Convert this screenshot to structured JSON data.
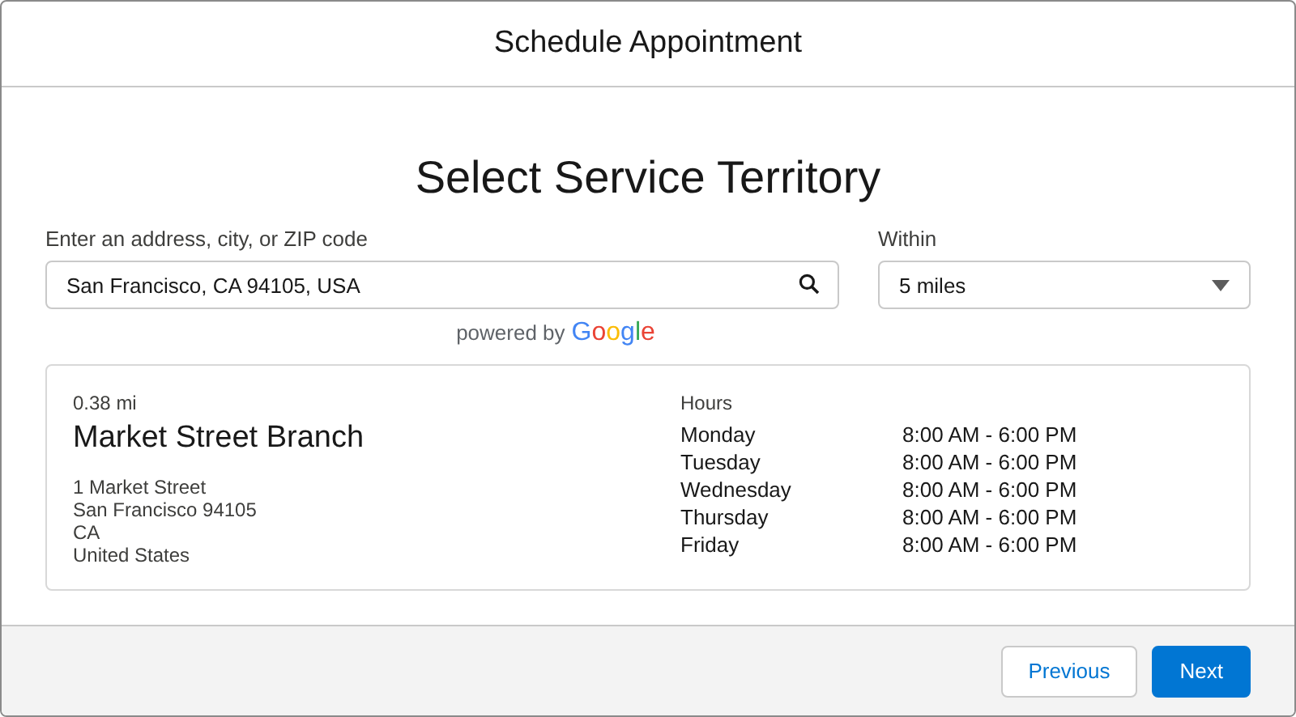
{
  "window": {
    "title": "Schedule Appointment"
  },
  "heading": "Select Service Territory",
  "address": {
    "label": "Enter an address, city, or ZIP code",
    "value": "San Francisco, CA 94105, USA"
  },
  "within": {
    "label": "Within",
    "value": "5 miles"
  },
  "attribution": {
    "text": "powered by",
    "logo": "Google"
  },
  "result": {
    "distance": "0.38 mi",
    "name": "Market Street Branch",
    "address_lines": [
      "1 Market Street",
      "San Francisco 94105",
      "CA",
      "United States"
    ],
    "hours_label": "Hours",
    "hours": [
      {
        "day": "Monday",
        "time": "8:00 AM - 6:00 PM"
      },
      {
        "day": "Tuesday",
        "time": "8:00 AM - 6:00 PM"
      },
      {
        "day": "Wednesday",
        "time": "8:00 AM - 6:00 PM"
      },
      {
        "day": "Thursday",
        "time": "8:00 AM - 6:00 PM"
      },
      {
        "day": "Friday",
        "time": "8:00 AM - 6:00 PM"
      }
    ]
  },
  "buttons": [
    {
      "label": "Previous",
      "kind": "neutral"
    },
    {
      "label": "Next",
      "kind": "brand"
    }
  ]
}
